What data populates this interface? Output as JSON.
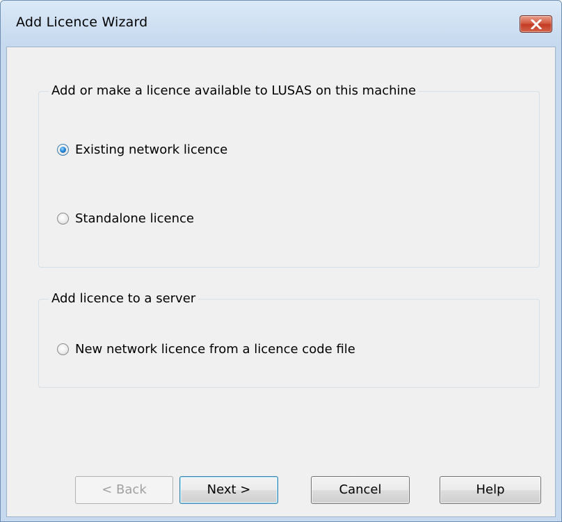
{
  "window": {
    "title": "Add Licence Wizard"
  },
  "group_machine": {
    "legend": "Add or make a licence available to LUSAS on this machine",
    "options": [
      {
        "label": "Existing network licence",
        "checked": true
      },
      {
        "label": "Standalone licence",
        "checked": false
      }
    ]
  },
  "group_server": {
    "legend": "Add licence to a server",
    "options": [
      {
        "label": "New network licence from a licence code file",
        "checked": false
      }
    ]
  },
  "buttons": {
    "back": "< Back",
    "next": "Next >",
    "cancel": "Cancel",
    "help": "Help"
  },
  "colors": {
    "title_bar": "#c6d9ee",
    "close_button": "#c94a30",
    "dialog_background": "#f0f0f0",
    "default_button_border": "#3c7fb1"
  },
  "icons": {
    "close": "close-icon"
  }
}
